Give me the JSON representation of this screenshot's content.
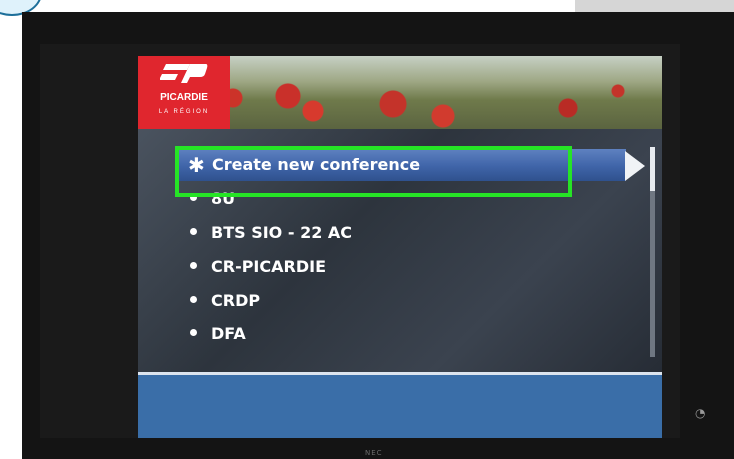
{
  "logo": {
    "name": "PICARDIE",
    "subtitle": "LA RÉGION"
  },
  "menu": {
    "selected_item": {
      "label": "Create new conference",
      "icon": "asterisk-icon"
    },
    "items": [
      {
        "label": "8U"
      },
      {
        "label": "BTS SIO - 22 AC"
      },
      {
        "label": "CR-PICARDIE"
      },
      {
        "label": "CRDP"
      },
      {
        "label": "DFA"
      }
    ]
  },
  "monitor": {
    "brand": "NEC"
  },
  "colors": {
    "logo_red": "#e0262e",
    "selection_blue": "#4268ad",
    "highlight_green": "#26e426",
    "footer_blue": "#3a6ea8"
  }
}
